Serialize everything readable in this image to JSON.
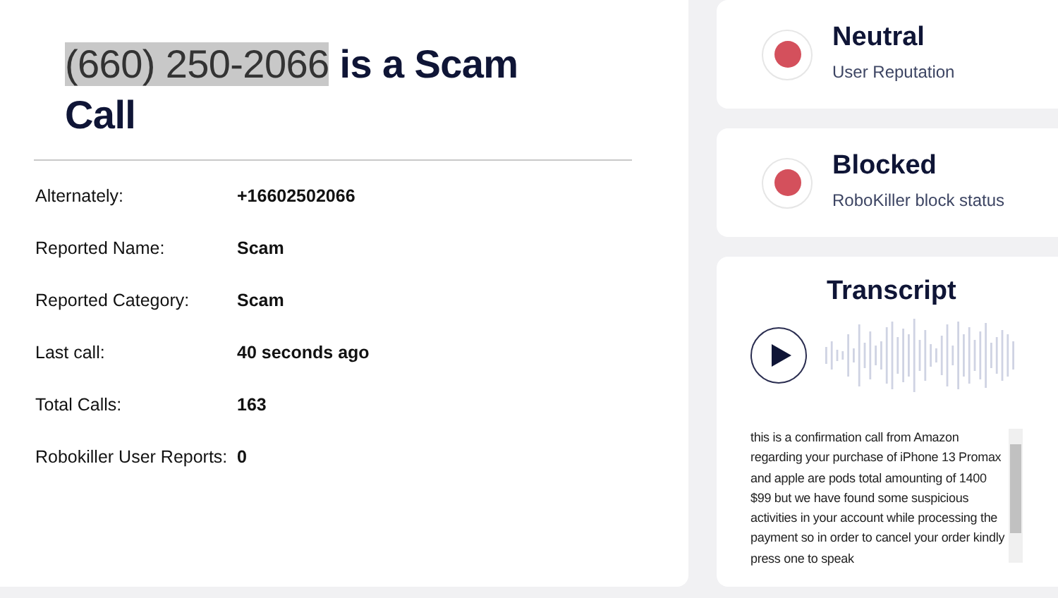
{
  "title": {
    "number": "(660) 250-2066",
    "number_highlighted": true,
    "rest": "is a Scam Call"
  },
  "details": [
    {
      "label": "Alternately:",
      "value": "+16602502066"
    },
    {
      "label": "Reported Name:",
      "value": "Scam"
    },
    {
      "label": "Reported Category:",
      "value": "Scam"
    },
    {
      "label": "Last call:",
      "value": "40 seconds ago"
    },
    {
      "label": "Total Calls:",
      "value": "163"
    },
    {
      "label": "Robokiller User Reports:",
      "value": "0"
    }
  ],
  "statuses": [
    {
      "title": "Neutral",
      "subtitle": "User Reputation",
      "color": "#d4505c"
    },
    {
      "title": "Blocked",
      "subtitle": "RoboKiller block status",
      "color": "#d4505c"
    }
  ],
  "transcript": {
    "title": "Transcript",
    "text": "this is a confirmation call from Amazon regarding your purchase of iPhone 13 Promax and apple are pods total amounting of 1400 $99 but we have found some suspicious activities in your account while processing the payment so in order to cancel your order kindly press one to speak"
  }
}
